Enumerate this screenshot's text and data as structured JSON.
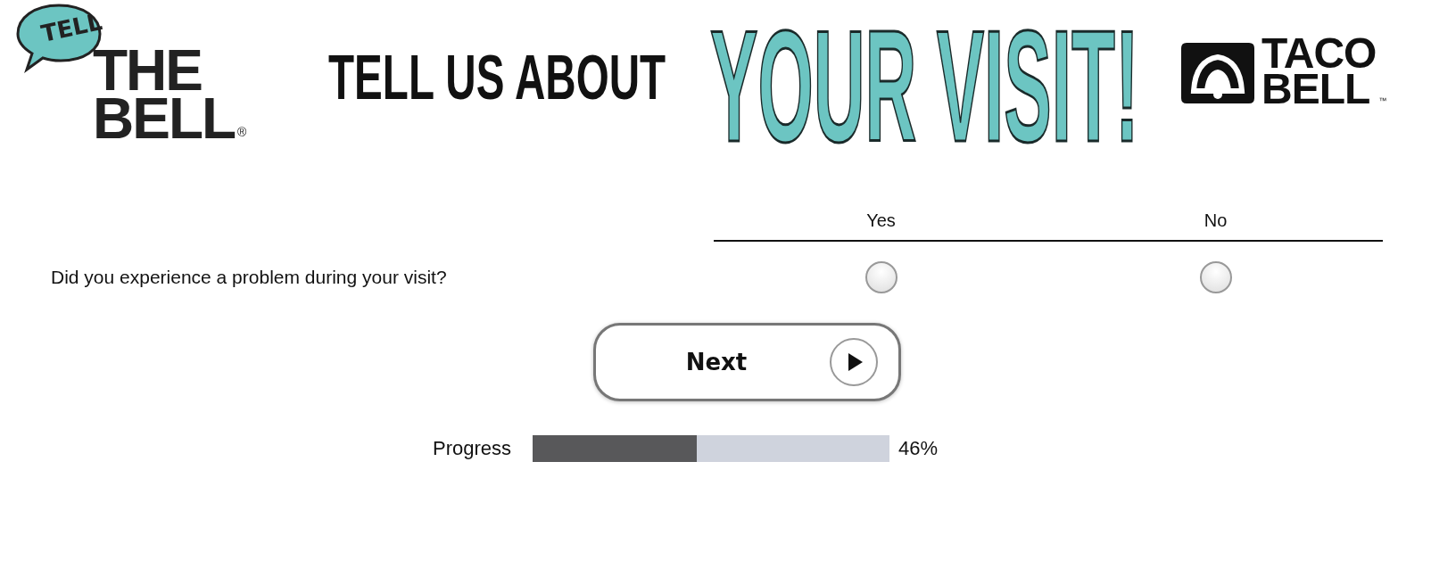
{
  "header": {
    "left_logo": {
      "bubble": "TELL",
      "lines": [
        "THE",
        "BELL"
      ],
      "mark": "®"
    },
    "headline": "TELL US ABOUT",
    "headline_big": "YOUR VISIT!",
    "right_logo": {
      "lines": [
        "TACO",
        "BELL"
      ],
      "mark": "™"
    }
  },
  "question": {
    "columns": [
      "Yes",
      "No"
    ],
    "text": "Did you experience a problem during your visit?",
    "options": [
      {
        "selected": false
      },
      {
        "selected": false
      }
    ]
  },
  "next_button": {
    "label": "Next"
  },
  "progress": {
    "label": "Progress",
    "level": 0.46,
    "reading": "46%"
  }
}
